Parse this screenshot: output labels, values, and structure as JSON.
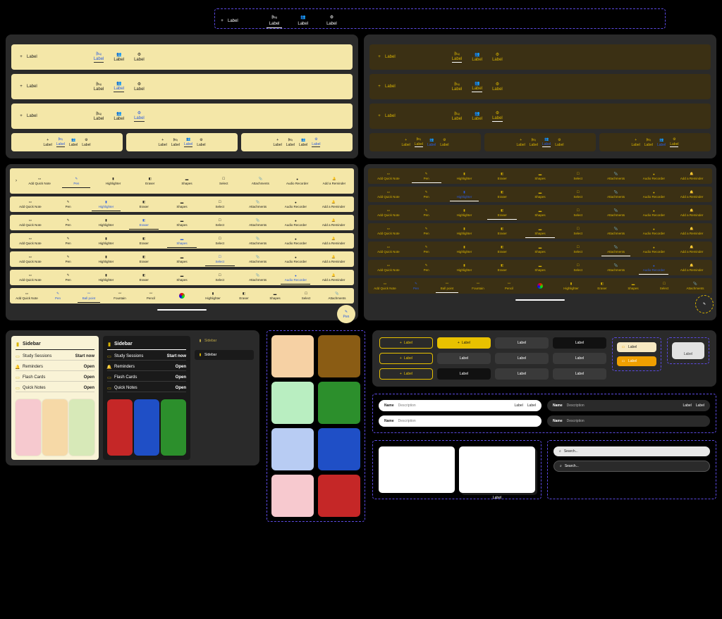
{
  "label": "Label",
  "tools": {
    "addQuickNote": "Add Quick Note",
    "pen": "Pen",
    "highlighter": "Highlighter",
    "eraser": "Eraser",
    "shapes": "Shapes",
    "select": "Select",
    "attachments": "Attachments",
    "audioRecorder": "Audio Recorder",
    "addReminder": "Add a Reminder",
    "ballPoint": "Ball point",
    "fountain": "Fountain",
    "pencil": "Pencil"
  },
  "sidebar": {
    "title": "Sidebar",
    "items": [
      {
        "label": "Study Sessions",
        "action": "Start now"
      },
      {
        "label": "Reminders",
        "action": "Open"
      },
      {
        "label": "Flash Cards",
        "action": "Open"
      },
      {
        "label": "Quick Notes",
        "action": "Open"
      }
    ]
  },
  "swatches": [
    "#f6d1a4",
    "#8a5c14",
    "#b9eec1",
    "#2c8f2c",
    "#b8ccf3",
    "#1f4fc6",
    "#f7c9cf",
    "#c52727"
  ],
  "chips": {
    "label_plus": "+ Label"
  },
  "field": {
    "name": "Name",
    "desc": "Description"
  },
  "search": {
    "placeholder": "Search..."
  },
  "open": "Open",
  "startNow": "Start now"
}
